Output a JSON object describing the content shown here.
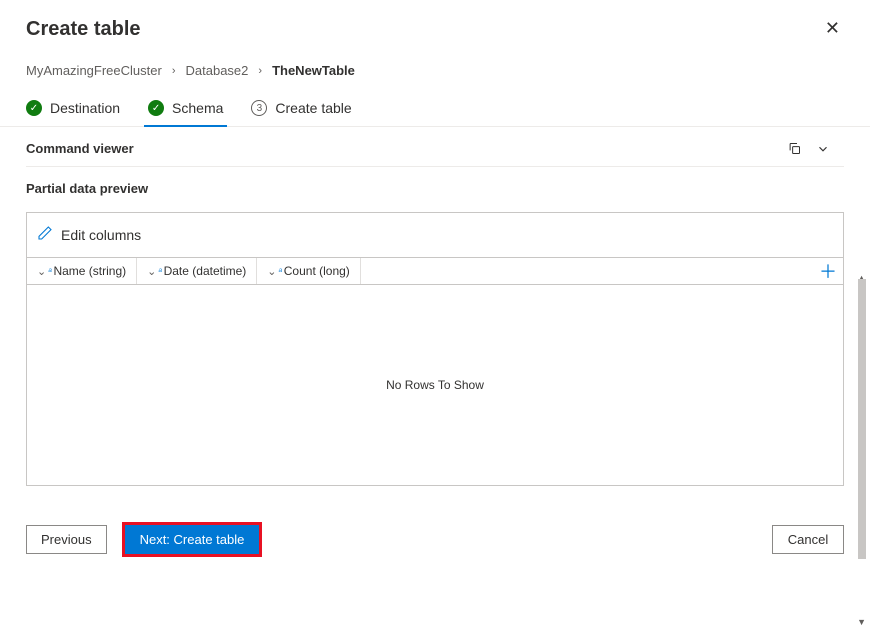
{
  "header": {
    "title": "Create table"
  },
  "breadcrumb": {
    "items": [
      "MyAmazingFreeCluster",
      "Database2",
      "TheNewTable"
    ]
  },
  "steps": [
    {
      "label": "Destination",
      "state": "done"
    },
    {
      "label": "Schema",
      "state": "done",
      "active": true
    },
    {
      "label": "Create table",
      "state": "pending",
      "num": "3"
    }
  ],
  "commandViewer": {
    "title": "Command viewer"
  },
  "preview": {
    "title": "Partial data preview",
    "editColumns": "Edit columns",
    "columns": [
      "Name (string)",
      "Date (datetime)",
      "Count (long)"
    ],
    "emptyMessage": "No Rows To Show"
  },
  "footer": {
    "previous": "Previous",
    "next": "Next: Create table",
    "cancel": "Cancel"
  }
}
